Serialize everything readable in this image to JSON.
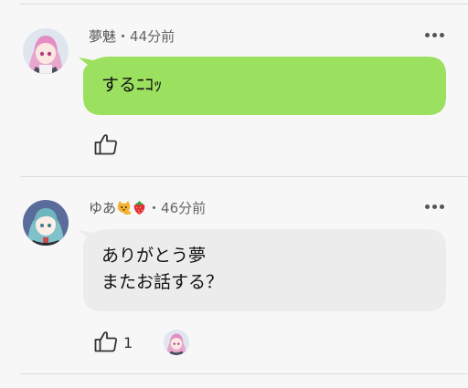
{
  "comments": [
    {
      "user": "夢魅",
      "separator": "・",
      "time": "44分前",
      "text": "するﾆｺｯ",
      "bubble_color": "#9be05e",
      "like_count": ""
    },
    {
      "user": "ゆあ",
      "separator": "・",
      "time": "46分前",
      "text": "ありがとう夢\nまたお話する？",
      "bubble_color": "#ececec",
      "like_count": "1",
      "name_emojis": [
        "cat-emoji",
        "strawberry-emoji"
      ]
    }
  ],
  "icons": {
    "more": "more-horizontal-icon",
    "like": "thumbs-up-icon"
  }
}
